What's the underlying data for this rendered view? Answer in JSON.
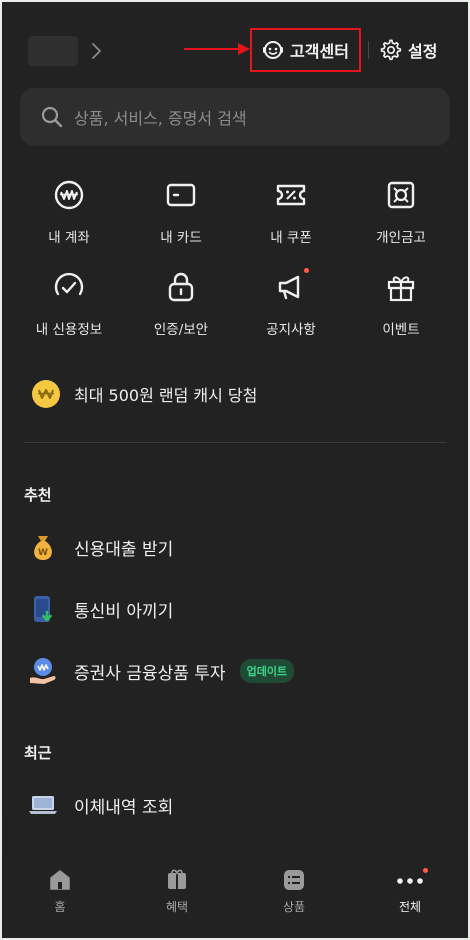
{
  "header": {
    "customer_center_label": "고객센터",
    "settings_label": "설정"
  },
  "search": {
    "placeholder": "상품, 서비스, 증명서 검색"
  },
  "quick_menu": [
    {
      "label": "내 계좌",
      "icon": "account-won-icon"
    },
    {
      "label": "내 카드",
      "icon": "card-icon"
    },
    {
      "label": "내 쿠폰",
      "icon": "coupon-icon"
    },
    {
      "label": "개인금고",
      "icon": "safe-icon"
    },
    {
      "label": "내 신용정보",
      "icon": "credit-gauge-icon"
    },
    {
      "label": "인증/보안",
      "icon": "lock-icon"
    },
    {
      "label": "공지사항",
      "icon": "megaphone-icon",
      "has_notification": true
    },
    {
      "label": "이벤트",
      "icon": "gift-icon"
    }
  ],
  "promo": {
    "text": "최대 500원 랜덤 캐시 당첨",
    "coin_color": "#f5c842"
  },
  "recommend": {
    "title": "추천",
    "items": [
      {
        "label": "신용대출 받기",
        "icon": "money-bag-icon"
      },
      {
        "label": "통신비 아끼기",
        "icon": "phone-save-icon"
      },
      {
        "label": "증권사 금융상품 투자",
        "icon": "invest-hand-icon",
        "badge": "업데이트"
      }
    ]
  },
  "recent": {
    "title": "최근",
    "items": [
      {
        "label": "이체내역 조회",
        "icon": "laptop-icon"
      }
    ]
  },
  "bottom_nav": [
    {
      "label": "홈",
      "icon": "home-icon"
    },
    {
      "label": "혜택",
      "icon": "benefit-icon"
    },
    {
      "label": "상품",
      "icon": "products-icon"
    },
    {
      "label": "전체",
      "icon": "more-dots-icon",
      "active": true,
      "has_notification": true
    }
  ],
  "colors": {
    "background": "#222222",
    "highlight_box": "#e5141a",
    "badge_text": "#3ed68a",
    "notification_dot": "#ff5a50"
  }
}
